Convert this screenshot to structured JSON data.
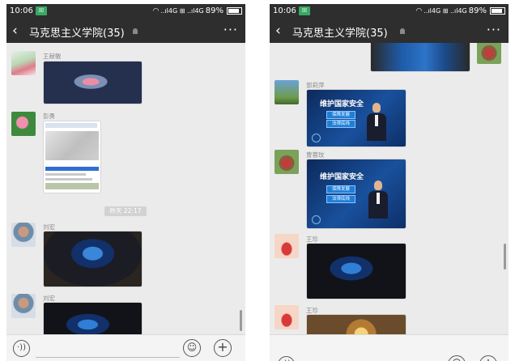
{
  "phones": [
    {
      "status": {
        "time": "10:06",
        "app_badge": "☒",
        "signal": "..ıl4G ⊞ ..ıl4G",
        "battery_percent": "89%"
      },
      "header": {
        "title": "马克思主义学院(35)"
      },
      "chat": {
        "messages": [
          {
            "sender": "王献敏",
            "content": "photo"
          },
          {
            "sender": "彭勇",
            "content": "screenshot"
          },
          {
            "divider": "昨天 22:17"
          },
          {
            "sender": "刘宏",
            "content": "photo"
          },
          {
            "sender": "刘宏",
            "content": "photo"
          }
        ]
      }
    },
    {
      "status": {
        "time": "10:06",
        "app_badge": "☒",
        "signal": "..ıl4G ⊞ ..ıl4G",
        "battery_percent": "89%"
      },
      "header": {
        "title": "马克思主义学院(35)"
      },
      "chat": {
        "messages": [
          {
            "sender": "郭莉萍",
            "content": "news_photo",
            "banner": "维护国家安全",
            "sub1": "保障发展",
            "sub2": "法律底线"
          },
          {
            "sender": "曹蓉玫",
            "content": "news_photo",
            "banner": "维护国家安全",
            "sub1": "保障发展",
            "sub2": "法律底线"
          },
          {
            "sender": "王珍",
            "content": "photo"
          },
          {
            "sender": "王珍",
            "content": "photo"
          }
        ]
      }
    }
  ],
  "icons": {
    "back": "‹",
    "more": "···",
    "voice": "·))",
    "emoji": "☺",
    "plus": "+",
    "wifi": "◠"
  },
  "colors": {
    "header": "#2e2e2e",
    "chat_bg": "#ebebeb",
    "badge_green": "#3aa865"
  }
}
